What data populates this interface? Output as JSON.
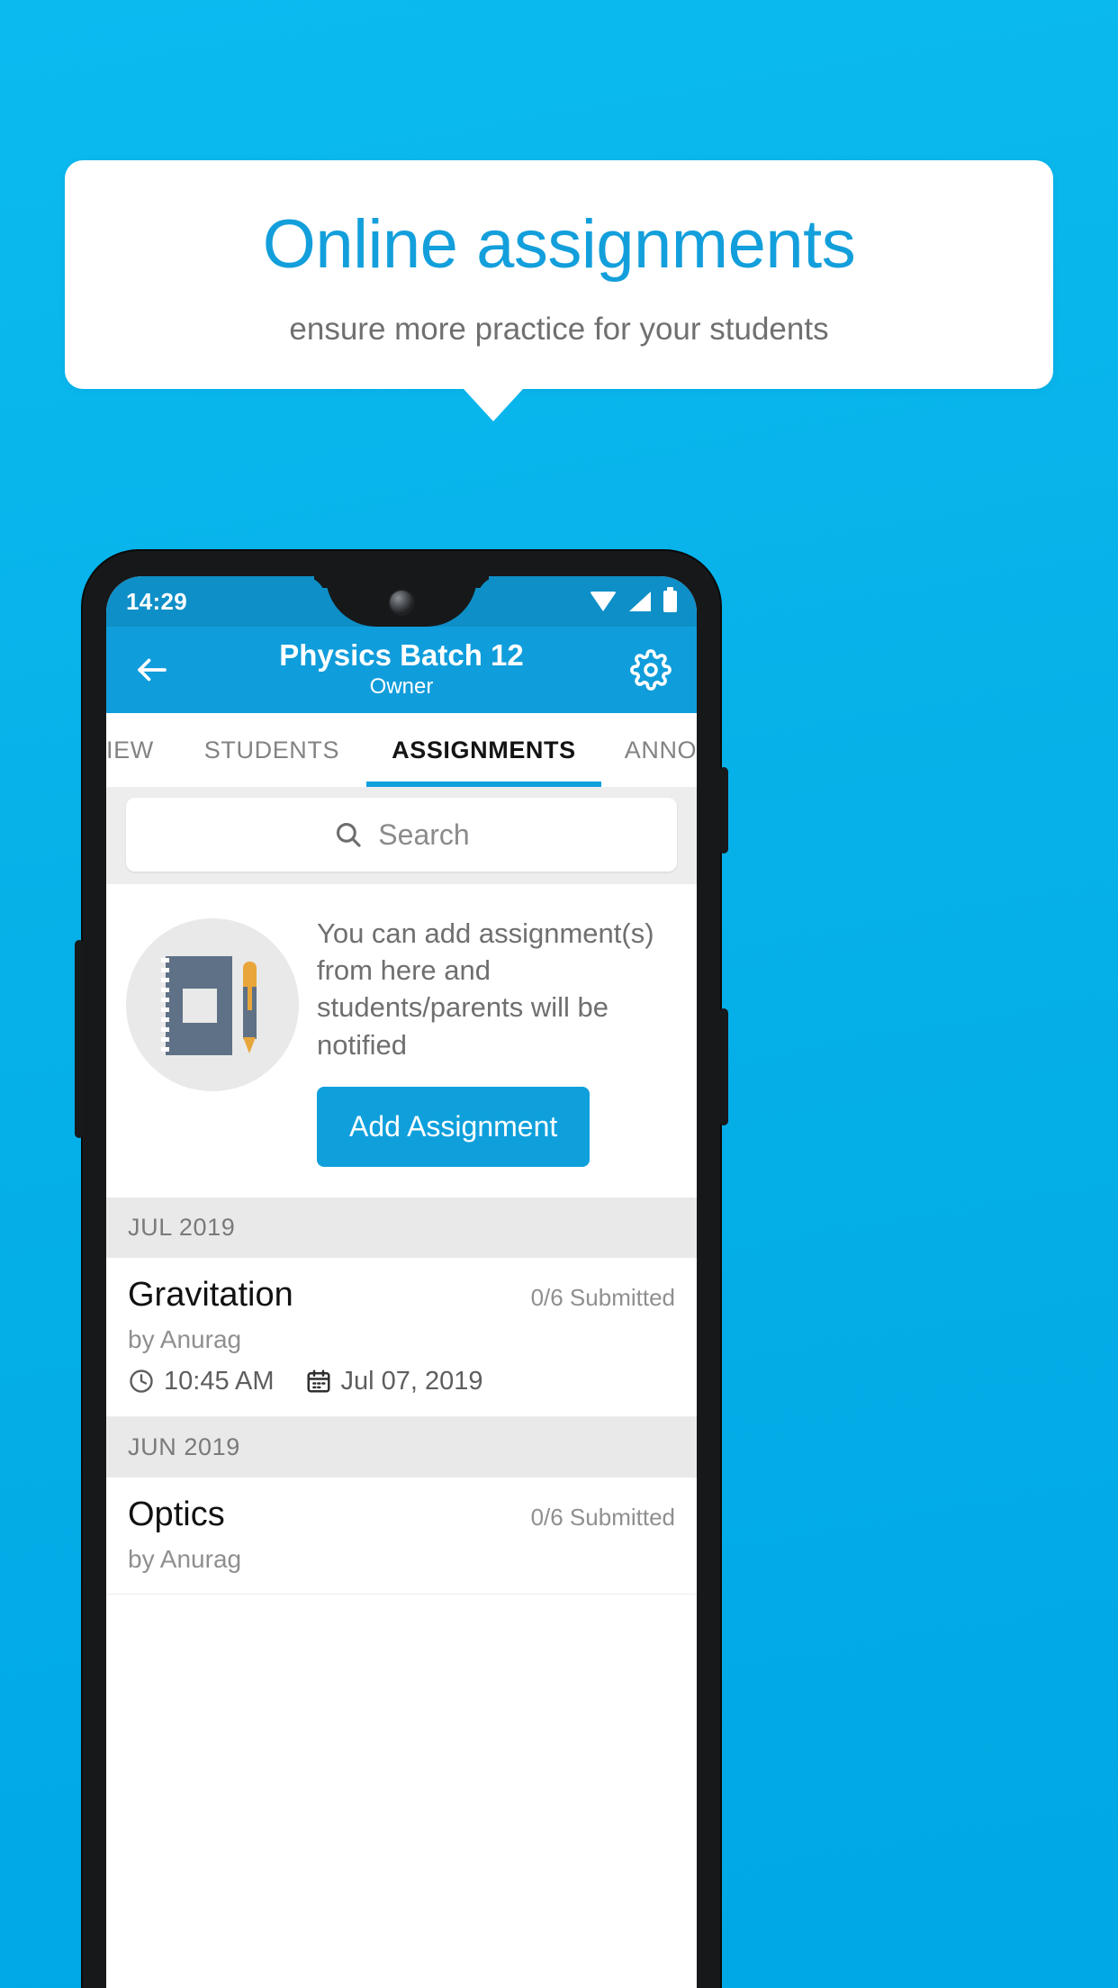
{
  "promo": {
    "title": "Online assignments",
    "subtitle": "ensure more practice for your students"
  },
  "colors": {
    "background": "#06b0e8",
    "brand": "#109ddb",
    "accent": "#0fa0dc",
    "statusbar": "#0e8fc7",
    "promo_title": "#139fdb"
  },
  "phone": {
    "statusbar": {
      "time": "14:29",
      "icons": [
        "wifi-icon",
        "signal-icon",
        "battery-icon"
      ]
    },
    "appbar": {
      "back_icon": "back-arrow-icon",
      "title": "Physics Batch 12",
      "subtitle": "Owner",
      "settings_icon": "gear-icon"
    },
    "tabs": [
      {
        "label": "IEW",
        "active": false
      },
      {
        "label": "STUDENTS",
        "active": false
      },
      {
        "label": "ASSIGNMENTS",
        "active": true
      },
      {
        "label": "ANNOUNCEM",
        "active": false
      }
    ],
    "search": {
      "icon": "search-icon",
      "placeholder": "Search",
      "value": ""
    },
    "empty_state": {
      "illustration": "notebook-and-pen-icon",
      "text": "You can add assignment(s) from here and students/parents will be notified",
      "button_label": "Add Assignment"
    },
    "groups": [
      {
        "month": "JUL 2019",
        "items": [
          {
            "title": "Gravitation",
            "submitted": "0/6 Submitted",
            "author": "by Anurag",
            "time": "10:45 AM",
            "date": "Jul 07, 2019"
          }
        ]
      },
      {
        "month": "JUN 2019",
        "items": [
          {
            "title": "Optics",
            "submitted": "0/6 Submitted",
            "author": "by Anurag",
            "time": "",
            "date": ""
          }
        ]
      }
    ]
  }
}
